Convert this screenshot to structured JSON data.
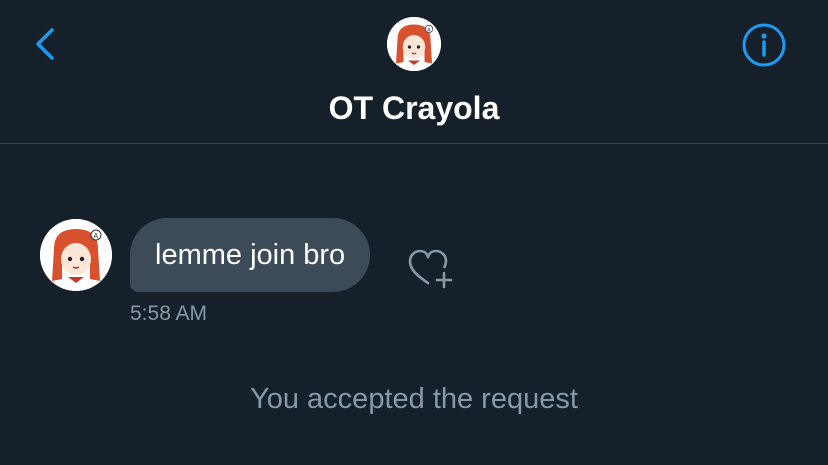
{
  "header": {
    "title": "OT Crayola",
    "back_icon": "chevron-left-icon",
    "info_icon": "info-circle-icon",
    "avatar": "anime-girl-avatar"
  },
  "conversation": {
    "messages": [
      {
        "sender": "OT Crayola",
        "text": "lemme join bro",
        "time": "5:58 AM",
        "reaction_icon": "heart-plus-icon"
      }
    ],
    "system_message": "You accepted the request"
  },
  "colors": {
    "background": "#15202b",
    "accent": "#1d9bf0",
    "bubble": "#3d4b59",
    "secondary_text": "#8899a6",
    "divider": "#38444d"
  }
}
